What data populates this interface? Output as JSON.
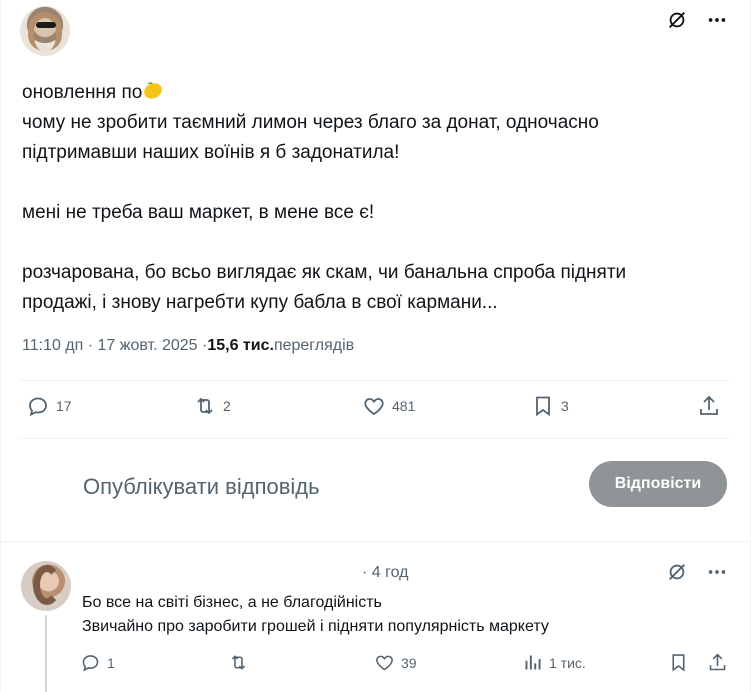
{
  "post": {
    "lines": [
      "оновлення по",
      "чому не зробити таємний лимон через благо за донат, одночасно",
      "підтримавши наших воїнів я б задонатила!",
      "мені не треба ваш маркет, в мене все є!",
      "розчарована, бо всьо виглядає як скам, чи банальна спроба підняти",
      "продажі, і знову нагребти купу бабла в свої кармани..."
    ],
    "time": "11:10 дп · 17 жовт. 2025 · ",
    "views_count": "15,6 тис.",
    "views_label": " переглядів",
    "replies": "17",
    "reposts": "2",
    "likes": "481",
    "bookmarks": "3"
  },
  "composer": {
    "placeholder": "Опублікувати відповідь",
    "button_label": "Відповісти"
  },
  "reply": {
    "time": "· 4 год",
    "line1": "Бо все на світі бізнес, а не благодійність",
    "line2": "Звичайно про заробити грошей і підняти популярність маркету",
    "replies": "1",
    "likes": "39",
    "views": "1 тис."
  },
  "colors": {
    "text": "#0f1419",
    "secondary": "#536471",
    "button_bg": "#8f9497"
  }
}
